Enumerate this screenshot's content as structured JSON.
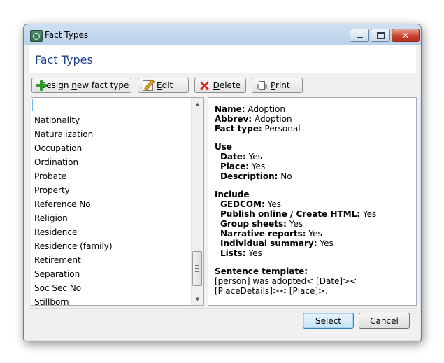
{
  "window": {
    "title": "Fact Types",
    "minimize_icon": "minimize-icon",
    "maximize_icon": "maximize-icon",
    "close_icon": "close-icon",
    "close_glyph": "✕"
  },
  "heading": "Fact Types",
  "toolbar": {
    "design_new": {
      "prefix": "Design ",
      "access": "n",
      "suffix": "ew fact type",
      "icon": "add-icon"
    },
    "edit": {
      "access": "E",
      "suffix": "dit",
      "icon": "edit-icon"
    },
    "delete": {
      "access": "D",
      "suffix": "elete",
      "icon": "delete-icon"
    },
    "print": {
      "access": "P",
      "suffix": "rint",
      "icon": "print-icon"
    }
  },
  "list": {
    "search_value": "",
    "items": [
      "Nationality",
      "Naturalization",
      "Occupation",
      "Ordination",
      "Probate",
      "Property",
      "Reference No",
      "Religion",
      "Residence",
      "Residence (family)",
      "Retirement",
      "Separation",
      "Soc Sec No",
      "Stillborn"
    ],
    "scroll_up_glyph": "▲",
    "scroll_down_glyph": "▼"
  },
  "details": {
    "name_label": "Name:",
    "name_value": "Adoption",
    "abbrev_label": "Abbrev:",
    "abbrev_value": "Adoption",
    "fact_type_label": "Fact type:",
    "fact_type_value": "Personal",
    "use_heading": "Use",
    "date_label": "Date:",
    "date_value": "Yes",
    "place_label": "Place:",
    "place_value": "Yes",
    "description_label": "Description:",
    "description_value": "No",
    "include_heading": "Include",
    "gedcom_label": "GEDCOM:",
    "gedcom_value": "Yes",
    "publish_label": "Publish online / Create HTML:",
    "publish_value": "Yes",
    "group_label": "Group sheets:",
    "group_value": "Yes",
    "narrative_label": "Narrative reports:",
    "narrative_value": "Yes",
    "individual_label": "Individual summary:",
    "individual_value": "Yes",
    "lists_label": "Lists:",
    "lists_value": "Yes",
    "sentence_heading": "Sentence template:",
    "sentence_value": "[person] was adopted< [Date]>< [PlaceDetails]>< [Place]>."
  },
  "footer": {
    "select": {
      "access": "S",
      "suffix": "elect"
    },
    "cancel_label": "Cancel"
  }
}
